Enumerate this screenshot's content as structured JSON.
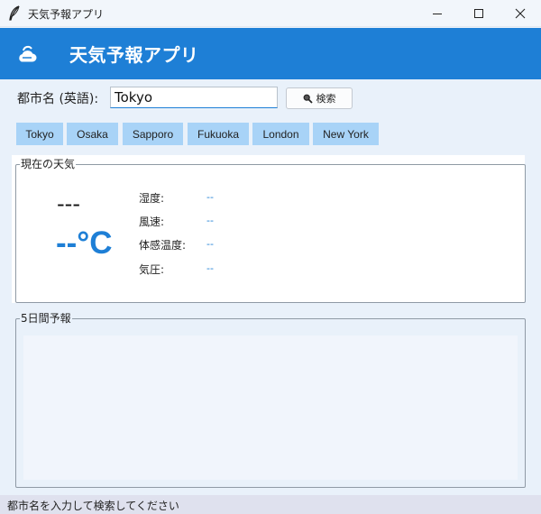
{
  "window": {
    "title": "天気予報アプリ",
    "icons": {
      "app": "feather-icon",
      "minimize": "minimize-icon",
      "maximize": "maximize-icon",
      "close": "close-icon"
    }
  },
  "header": {
    "title": "天気予報アプリ",
    "icon": "cloud-sun-icon",
    "background": "#1e7fd6"
  },
  "search": {
    "label": "都市名 (英語):",
    "value": "Tokyo",
    "button_label": "検索",
    "button_icon": "magnifier-icon"
  },
  "quick_cities": [
    "Tokyo",
    "Osaka",
    "Sapporo",
    "Fukuoka",
    "London",
    "New York"
  ],
  "current": {
    "section_title": "現在の天気",
    "condition": "---",
    "temperature": "--°C",
    "details": [
      {
        "label": "湿度:",
        "value": "--"
      },
      {
        "label": "風速:",
        "value": "--"
      },
      {
        "label": "体感温度:",
        "value": "--"
      },
      {
        "label": "気圧:",
        "value": "--"
      }
    ]
  },
  "forecast": {
    "section_title": "5日間予報"
  },
  "status": {
    "text": "都市名を入力して検索してください"
  },
  "colors": {
    "accent": "#1e7fd6",
    "quick_button": "#a8d3f7",
    "window_bg": "#e9f1fa"
  }
}
